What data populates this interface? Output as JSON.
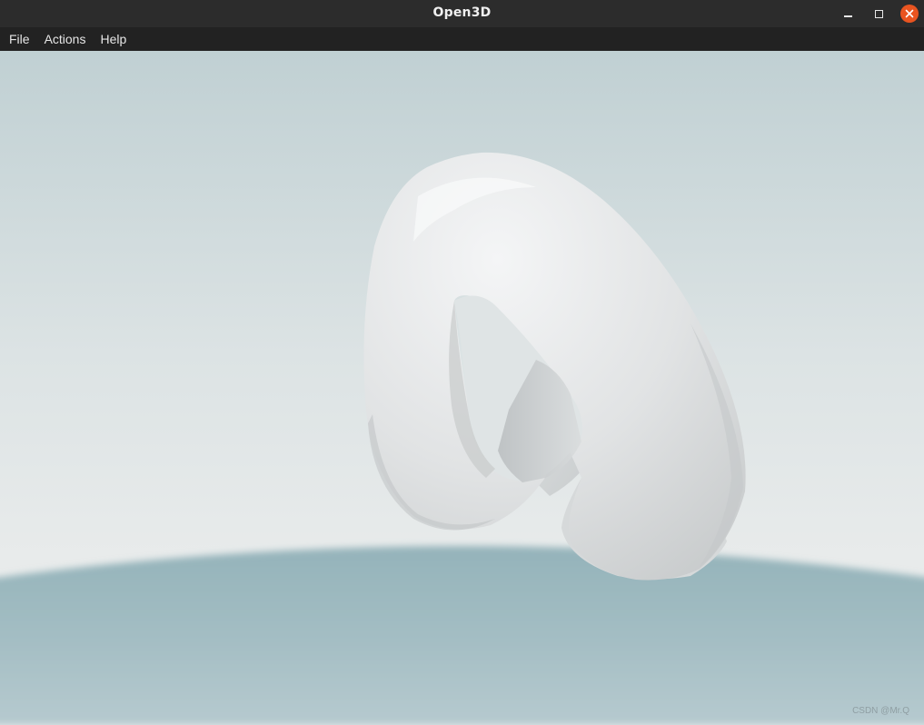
{
  "window": {
    "title": "Open3D",
    "controls": {
      "minimize": "minimize-icon",
      "maximize": "maximize-icon",
      "close": "close-icon"
    },
    "close_color": "#e95420"
  },
  "menubar": {
    "items": [
      {
        "label": "File"
      },
      {
        "label": "Actions"
      },
      {
        "label": "Help"
      }
    ]
  },
  "viewport": {
    "scene": "torus-knot-mesh",
    "background_colors": {
      "sky": "#c3d2d5",
      "horizon": "#e6eaeb",
      "ground": "#9fbac0"
    },
    "watermark": "CSDN @Mr.Q"
  }
}
